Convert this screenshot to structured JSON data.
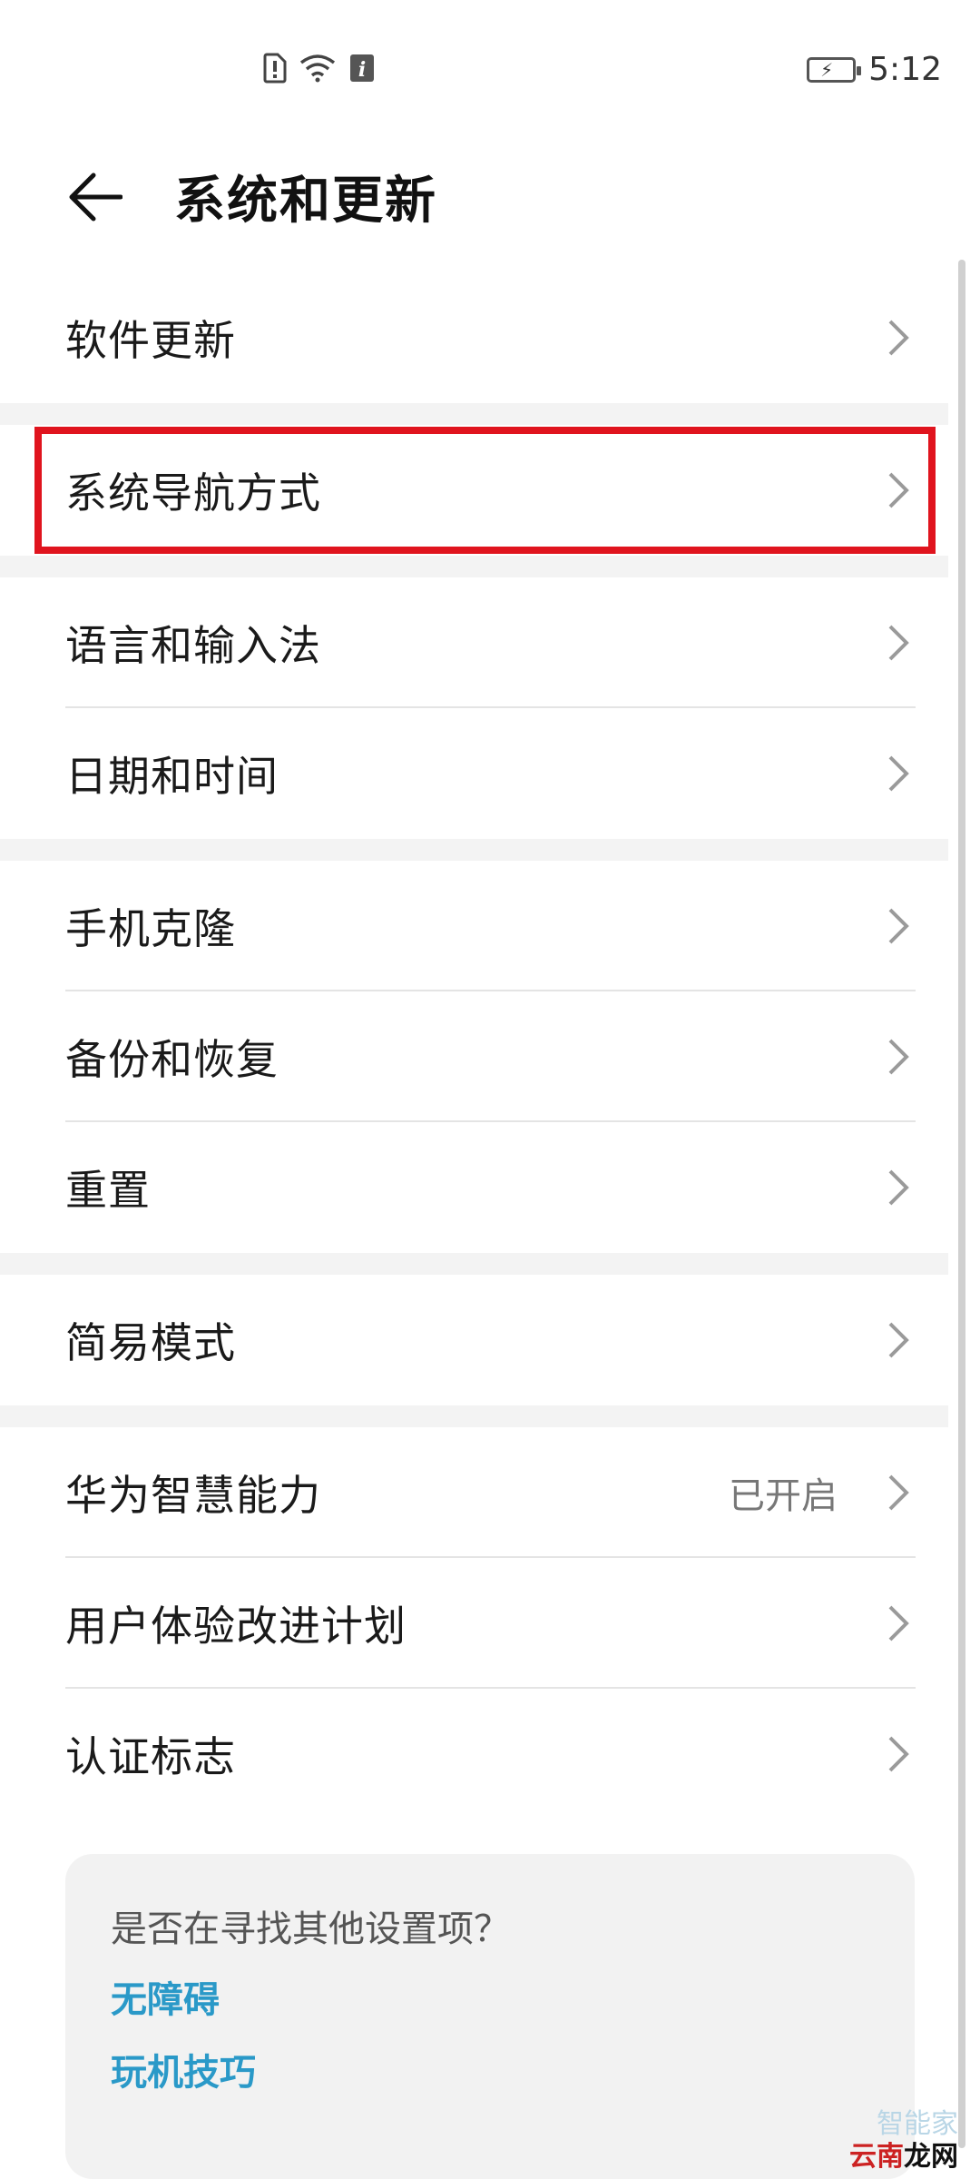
{
  "status_bar": {
    "time": "5:12",
    "icons": [
      "sim-alert-icon",
      "wifi-icon",
      "info-icon",
      "battery-charging-icon"
    ]
  },
  "header": {
    "title": "系统和更新",
    "back_icon": "back-arrow-icon"
  },
  "groups": [
    {
      "items": [
        {
          "label": "软件更新"
        }
      ]
    },
    {
      "items": [
        {
          "label": "系统导航方式",
          "highlighted": true
        }
      ]
    },
    {
      "items": [
        {
          "label": "语言和输入法"
        },
        {
          "label": "日期和时间"
        }
      ]
    },
    {
      "items": [
        {
          "label": "手机克隆"
        },
        {
          "label": "备份和恢复"
        },
        {
          "label": "重置"
        }
      ]
    },
    {
      "items": [
        {
          "label": "简易模式"
        }
      ]
    },
    {
      "items": [
        {
          "label": "华为智慧能力",
          "value": "已开启"
        },
        {
          "label": "用户体验改进计划"
        },
        {
          "label": "认证标志"
        }
      ]
    }
  ],
  "suggestions": {
    "question": "是否在寻找其他设置项？",
    "links": [
      "无障碍",
      "玩机技巧"
    ]
  },
  "watermark": {
    "top": "智能家",
    "main_red": "云南",
    "main_black": "龙网"
  },
  "colors": {
    "highlight_border": "#e0141e",
    "link": "#2a99c8",
    "group_gap": "#f3f3f3"
  }
}
